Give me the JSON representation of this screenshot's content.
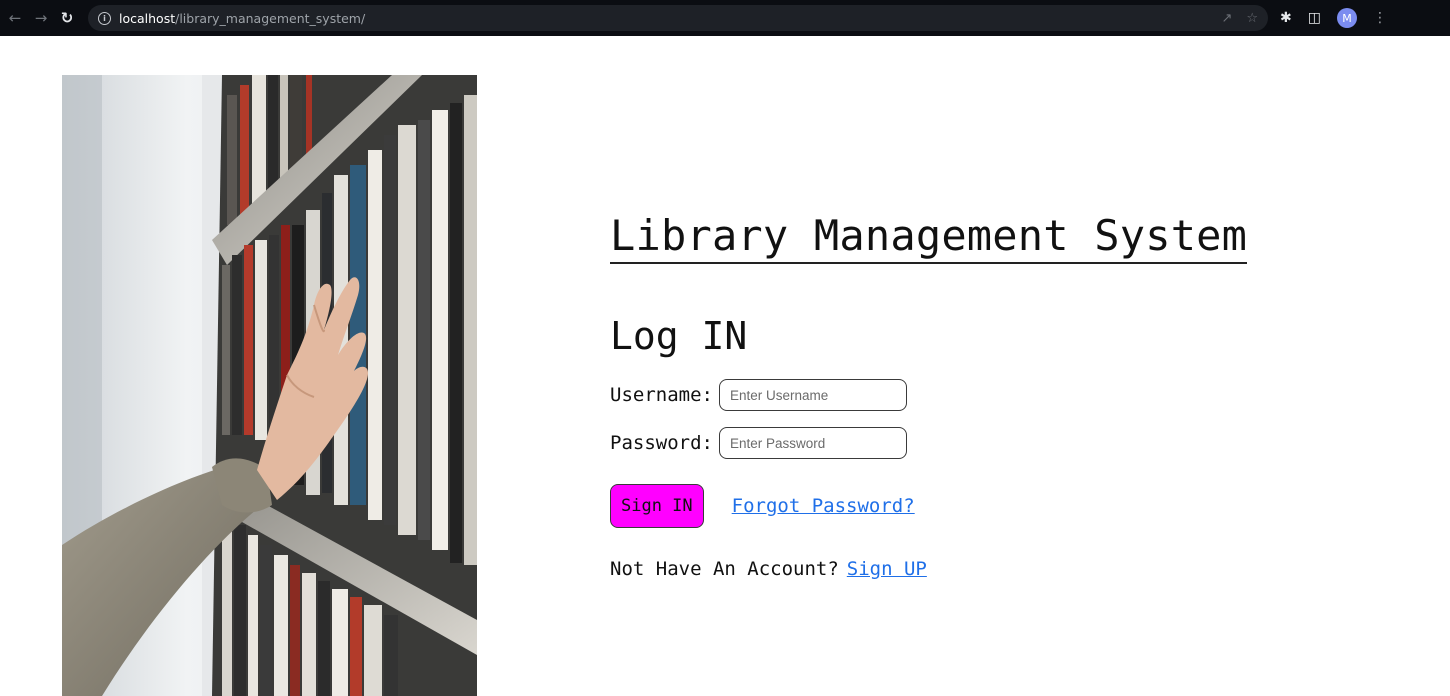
{
  "browser": {
    "back_icon": "arrow-left",
    "forward_icon": "arrow-right",
    "reload_icon": "reload",
    "url_host": "localhost",
    "url_path": "/library_management_system/",
    "share_icon": "share",
    "bookmark_icon": "star",
    "extensions_icon": "puzzle",
    "sidepanel_icon": "side-panel",
    "profile_initial": "M",
    "profile_color": "#7b8cf0",
    "menu_icon": "kebab"
  },
  "page": {
    "title": "Library Management System",
    "login_heading": "Log IN",
    "username_label": "Username:",
    "username_placeholder": "Enter Username",
    "password_label": "Password:",
    "password_placeholder": "Enter Password",
    "signin_label": "Sign IN",
    "forgot_label": "Forgot Password?",
    "no_account_text": "Not Have An Account?",
    "signup_label": "Sign UP",
    "signin_color": "#ff00ff",
    "link_color": "#1f6fe8"
  }
}
